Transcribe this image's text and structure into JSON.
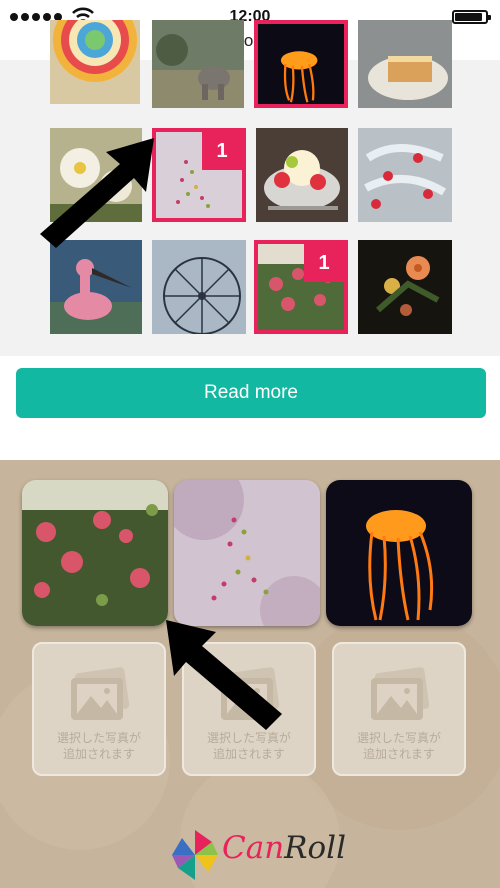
{
  "status_bar": {
    "time": "12:00",
    "signal_dots": 5,
    "battery_level_pct": 90
  },
  "browser": {
    "url": "canroll.net"
  },
  "gallery": {
    "read_more_label": "Read more",
    "thumbnails": [
      {
        "name": "lollipop",
        "selected": false,
        "badge": ""
      },
      {
        "name": "elephant",
        "selected": false,
        "badge": ""
      },
      {
        "name": "jellyfish",
        "selected": true,
        "badge": ""
      },
      {
        "name": "cake",
        "selected": false,
        "badge": ""
      },
      {
        "name": "flowers",
        "selected": false,
        "badge": ""
      },
      {
        "name": "blossom",
        "selected": true,
        "badge": "1"
      },
      {
        "name": "ice-cream",
        "selected": false,
        "badge": ""
      },
      {
        "name": "ribbons",
        "selected": false,
        "badge": ""
      },
      {
        "name": "duck",
        "selected": false,
        "badge": ""
      },
      {
        "name": "ferris-wheel",
        "selected": false,
        "badge": ""
      },
      {
        "name": "roses",
        "selected": true,
        "badge": "1"
      },
      {
        "name": "bouquet",
        "selected": false,
        "badge": ""
      }
    ]
  },
  "selected_photos": [
    {
      "name": "roses"
    },
    {
      "name": "blossom"
    },
    {
      "name": "jellyfish"
    }
  ],
  "empty_slots": [
    {
      "line1": "選択した写真が",
      "line2": "追加されます"
    },
    {
      "line1": "選択した写真が",
      "line2": "追加されます"
    },
    {
      "line1": "選択した写真が",
      "line2": "追加されます"
    }
  ],
  "logo": {
    "part1": "Can",
    "part2": "Roll"
  },
  "colors": {
    "accent_pink": "#e8225b",
    "button_teal": "#12b8a1",
    "kraft_background": "#c7b49c"
  }
}
